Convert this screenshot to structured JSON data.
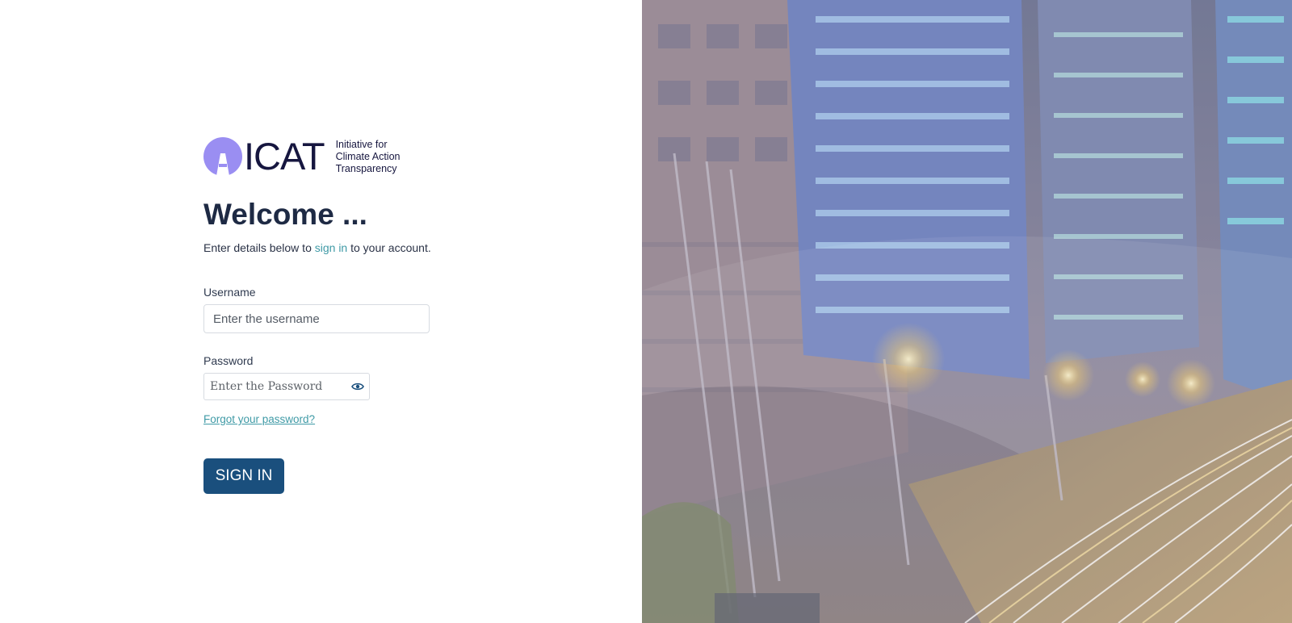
{
  "logo": {
    "word": "ICAT",
    "tagline": [
      "Initiative for",
      "Climate Action",
      "Transparency"
    ],
    "colors": {
      "mark": "#9a8ef2",
      "text": "#16163f"
    }
  },
  "welcome": {
    "title": "Welcome ...",
    "subtitle_before": "Enter details below to ",
    "subtitle_link": "sign in",
    "subtitle_after": " to your account."
  },
  "form": {
    "username_label": "Username",
    "username_placeholder": "Enter the username",
    "username_value": "",
    "password_label": "Password",
    "password_placeholder": "Enter the Password",
    "password_value": "",
    "password_toggle_icon": "eye-icon",
    "forgot_link": "Forgot your password?",
    "submit_label": "SIGN IN"
  },
  "hero": {
    "description_icon": "city-night-image"
  },
  "colors": {
    "accent": "#3f9aa6",
    "primary_button": "#1a4f7d",
    "heading": "#1e2a44"
  }
}
